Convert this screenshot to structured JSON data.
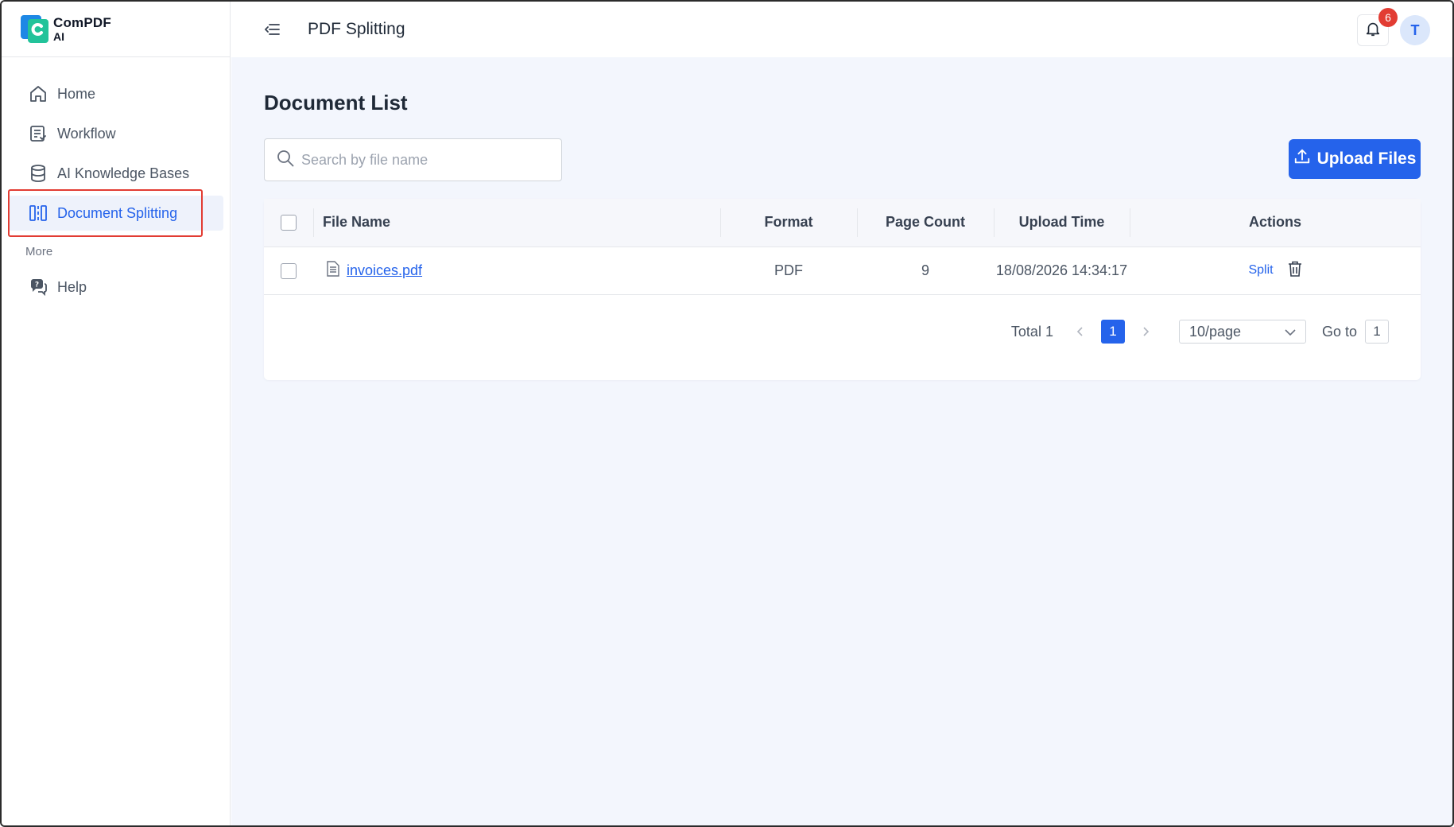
{
  "brand": {
    "name": "ComPDF",
    "sub": "AI"
  },
  "sidebar": {
    "items": [
      {
        "label": "Home",
        "icon": "home-icon"
      },
      {
        "label": "Workflow",
        "icon": "workflow-icon"
      },
      {
        "label": "AI Knowledge Bases",
        "icon": "database-icon"
      },
      {
        "label": "Document Splitting",
        "icon": "split-icon",
        "active": true
      }
    ],
    "section_more": "More",
    "more_items": [
      {
        "label": "Help",
        "icon": "help-chat-icon"
      }
    ]
  },
  "header": {
    "title": "PDF Splitting",
    "notification_count": "6",
    "avatar_initial": "T"
  },
  "main": {
    "title": "Document List",
    "search_placeholder": "Search by file name",
    "upload_label": "Upload Files"
  },
  "table": {
    "columns": [
      "File Name",
      "Format",
      "Page Count",
      "Upload Time",
      "Actions"
    ],
    "rows": [
      {
        "file_name": "invoices.pdf",
        "format": "PDF",
        "page_count": "9",
        "upload_time": "18/08/2026 14:34:17",
        "action": "Split"
      }
    ]
  },
  "pagination": {
    "total": "Total 1",
    "current_page": "1",
    "page_size": "10/page",
    "goto_label": "Go to",
    "goto_value": "1"
  },
  "colors": {
    "accent": "#2563eb",
    "badge": "#e23c33",
    "highlight_box": "#e23c33",
    "main_bg": "#f3f6fd"
  }
}
